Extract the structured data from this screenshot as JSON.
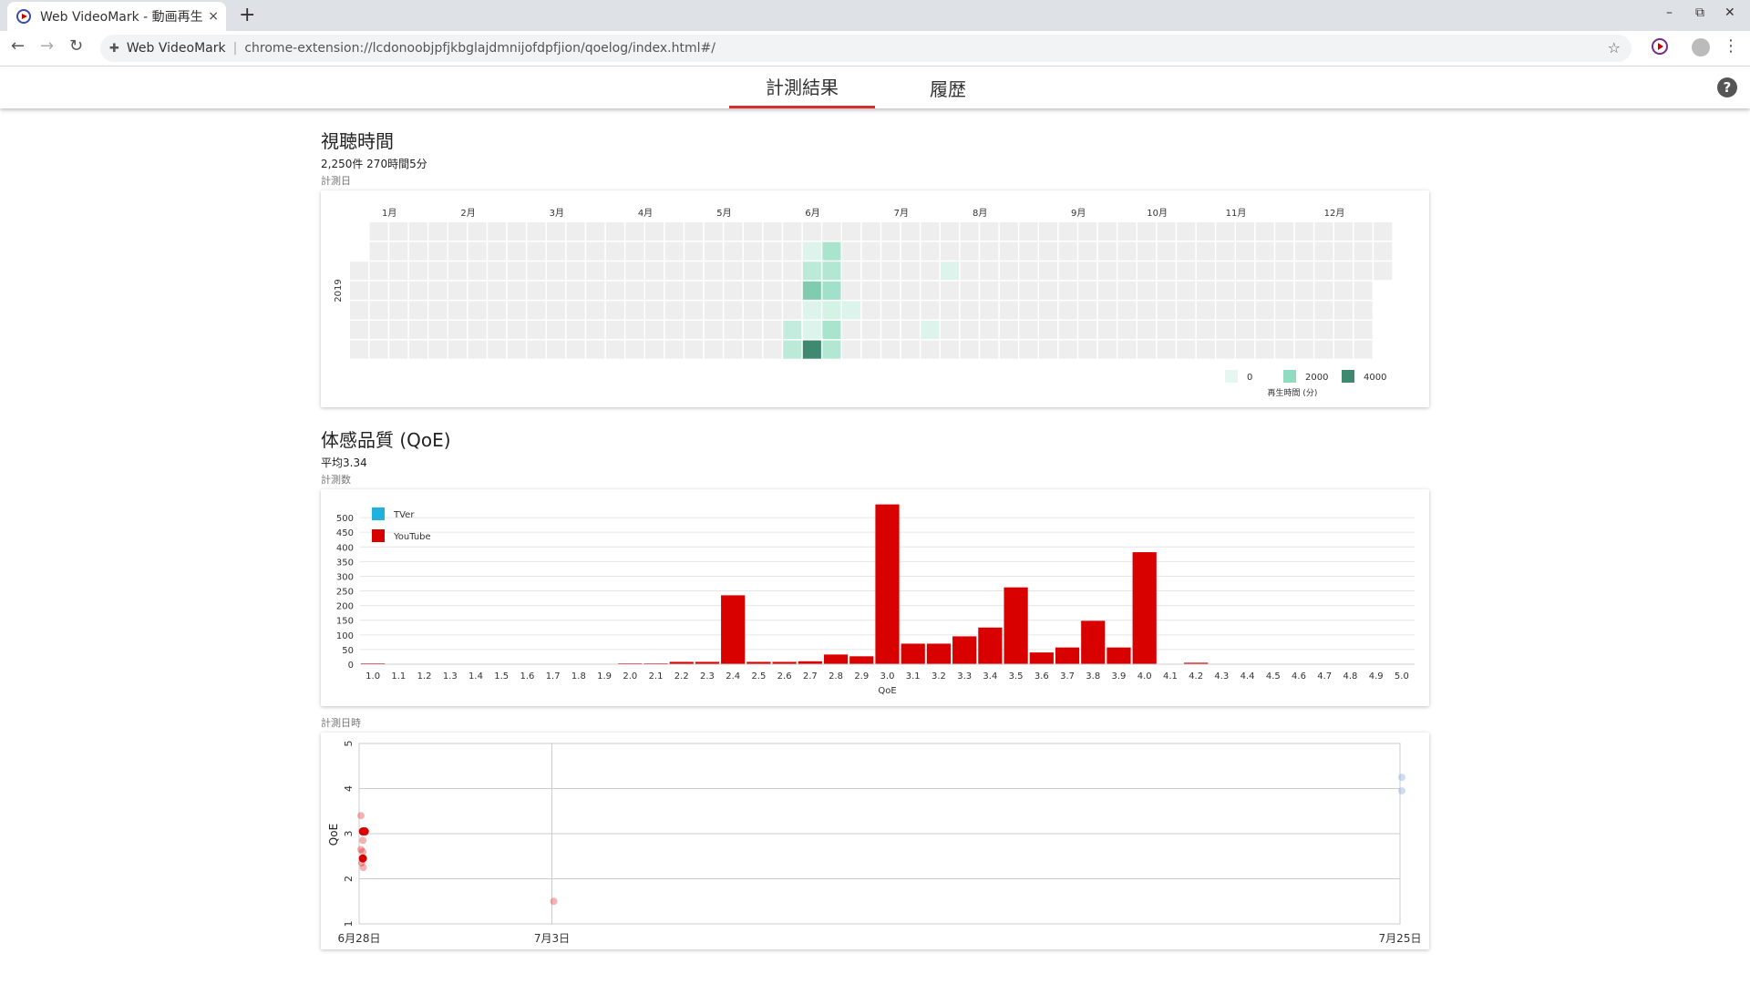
{
  "browser": {
    "tab_title": "Web VideoMark - 動画再生",
    "new_tab_glyph": "+",
    "close_glyph": "×",
    "site_name": "Web VideoMark",
    "url": "chrome-extension://lcdonoobjpfjkbglajdmnijofdpfjion/qoelog/index.html#/",
    "window_controls": [
      "–",
      "⧉",
      "✕"
    ]
  },
  "nav": {
    "tabs": [
      {
        "label": "計測結果",
        "active": true
      },
      {
        "label": "履歴",
        "active": false
      }
    ],
    "help_glyph": "?"
  },
  "viewing": {
    "title": "視聴時間",
    "summary": "2,250件 270時間5分",
    "caption": "計測日",
    "year": "2019",
    "months": [
      "1月",
      "2月",
      "3月",
      "4月",
      "5月",
      "6月",
      "7月",
      "8月",
      "9月",
      "10月",
      "11月",
      "12月"
    ],
    "legend": {
      "items": [
        {
          "label": "0",
          "color": "#e6f7f1"
        },
        {
          "label": "2000",
          "color": "#8fdcc1"
        },
        {
          "label": "4000",
          "color": "#3d8a70"
        }
      ],
      "title": "再生時間 (分)"
    },
    "empty_color": "#eeeeee",
    "active_cells": [
      {
        "week": 23,
        "day": 1,
        "level": 0.05
      },
      {
        "week": 24,
        "day": 1,
        "level": 0.35
      },
      {
        "week": 23,
        "day": 2,
        "level": 0.25
      },
      {
        "week": 24,
        "day": 2,
        "level": 0.3
      },
      {
        "week": 23,
        "day": 3,
        "level": 0.6
      },
      {
        "week": 24,
        "day": 3,
        "level": 0.4
      },
      {
        "week": 23,
        "day": 4,
        "level": 0.05
      },
      {
        "week": 24,
        "day": 4,
        "level": 0.1
      },
      {
        "week": 25,
        "day": 4,
        "level": 0.05
      },
      {
        "week": 22,
        "day": 5,
        "level": 0.2
      },
      {
        "week": 23,
        "day": 5,
        "level": 0.05
      },
      {
        "week": 24,
        "day": 5,
        "level": 0.35
      },
      {
        "week": 29,
        "day": 5,
        "level": 0.05
      },
      {
        "week": 22,
        "day": 6,
        "level": 0.25
      },
      {
        "week": 23,
        "day": 6,
        "level": 1.0
      },
      {
        "week": 24,
        "day": 6,
        "level": 0.3
      },
      {
        "week": 22,
        "day": 7,
        "level": 0.05
      },
      {
        "week": 30,
        "day": 2,
        "level": 0.05
      }
    ]
  },
  "qoe": {
    "title": "体感品質 (QoE)",
    "summary": "平均3.34",
    "caption": "計測数",
    "timeline_caption": "計測日時"
  },
  "chart_data": [
    {
      "type": "bar",
      "title": "",
      "xlabel": "QoE",
      "ylabel": "",
      "ylim": [
        0,
        550
      ],
      "yticks": [
        0,
        50,
        100,
        150,
        200,
        250,
        300,
        350,
        400,
        450,
        500
      ],
      "categories": [
        "1.0",
        "1.1",
        "1.2",
        "1.3",
        "1.4",
        "1.5",
        "1.6",
        "1.7",
        "1.8",
        "1.9",
        "2.0",
        "2.1",
        "2.2",
        "2.3",
        "2.4",
        "2.5",
        "2.6",
        "2.7",
        "2.8",
        "2.9",
        "3.0",
        "3.1",
        "3.2",
        "3.3",
        "3.4",
        "3.5",
        "3.6",
        "3.7",
        "3.8",
        "3.9",
        "4.0",
        "4.1",
        "4.2",
        "4.3",
        "4.4",
        "4.5",
        "4.6",
        "4.7",
        "4.8",
        "4.9",
        "5.0"
      ],
      "legend": [
        {
          "name": "TVer",
          "color": "#1fb2dc"
        },
        {
          "name": "YouTube",
          "color": "#d90000"
        }
      ],
      "series": [
        {
          "name": "TVer",
          "values": [
            0,
            0,
            0,
            0,
            0,
            0,
            0,
            0,
            0,
            0,
            0,
            0,
            0,
            0,
            0,
            0,
            0,
            0,
            0,
            0,
            0,
            0,
            0,
            0,
            0,
            0,
            0,
            0,
            0,
            0,
            0,
            0,
            0,
            0,
            0,
            0,
            0,
            0,
            0,
            0,
            0
          ]
        },
        {
          "name": "YouTube",
          "values": [
            3,
            0,
            0,
            0,
            0,
            0,
            0,
            0,
            0,
            0,
            3,
            3,
            8,
            8,
            235,
            8,
            8,
            10,
            33,
            27,
            545,
            70,
            70,
            95,
            125,
            262,
            40,
            57,
            148,
            57,
            382,
            0,
            5,
            0,
            0,
            0,
            0,
            0,
            0,
            0,
            0
          ]
        }
      ]
    },
    {
      "type": "scatter",
      "title": "",
      "xlabel": "",
      "ylabel": "QoE",
      "ylim": [
        1,
        5
      ],
      "yticks": [
        "1",
        "2",
        "3",
        "4",
        "5"
      ],
      "xticks": [
        "6月28日",
        "7月3日",
        "7月25日"
      ],
      "xtick_days": [
        0,
        5,
        27
      ],
      "xlim_days": [
        0,
        27
      ],
      "series": [
        {
          "name": "YouTube",
          "color": "#d90000",
          "points": [
            {
              "day": 0.05,
              "qoe": 3.05,
              "strong": true
            },
            {
              "day": 0.1,
              "qoe": 3.05,
              "strong": true
            },
            {
              "day": 0.05,
              "qoe": 2.45,
              "strong": true
            },
            {
              "day": 0.0,
              "qoe": 3.4,
              "strong": false
            },
            {
              "day": 0.05,
              "qoe": 2.85,
              "strong": false
            },
            {
              "day": 0.0,
              "qoe": 2.65,
              "strong": false
            },
            {
              "day": 0.05,
              "qoe": 2.6,
              "strong": false
            },
            {
              "day": 0.02,
              "qoe": 2.35,
              "strong": false
            },
            {
              "day": 0.06,
              "qoe": 2.25,
              "strong": false
            },
            {
              "day": 5.0,
              "qoe": 1.5,
              "strong": false
            }
          ]
        },
        {
          "name": "TVer",
          "color": "#5b8fd6",
          "points": [
            {
              "day": 27.0,
              "qoe": 4.25,
              "strong": false
            },
            {
              "day": 27.0,
              "qoe": 3.95,
              "strong": false
            }
          ]
        }
      ]
    }
  ]
}
